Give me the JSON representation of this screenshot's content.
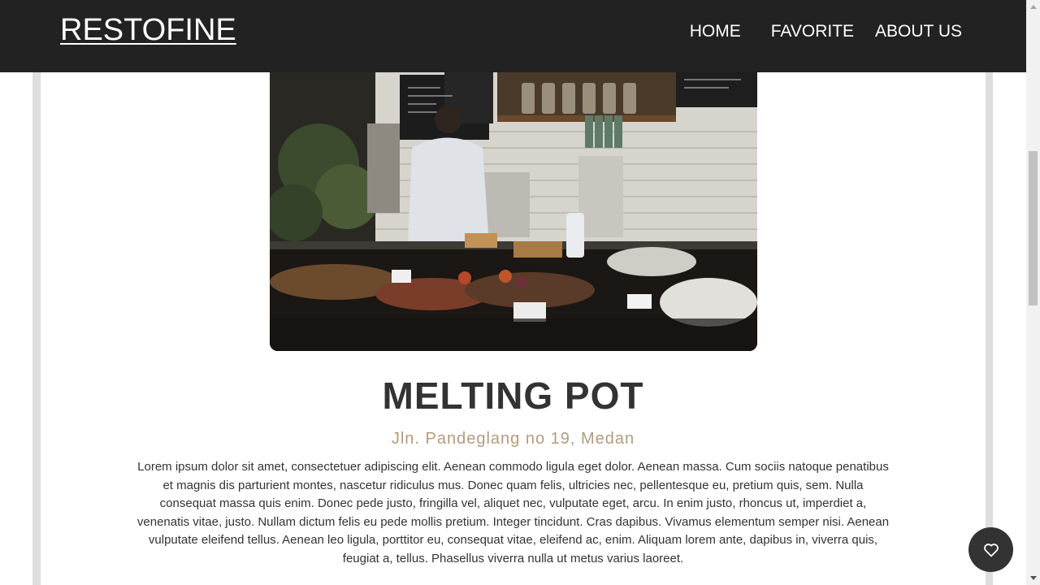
{
  "header": {
    "brand": "RESTOFINE",
    "nav": {
      "home": "HOME",
      "favorite": "FAVORITE",
      "about": "ABOUT US"
    }
  },
  "restaurant": {
    "name": "MELTING POT",
    "address": "Jln. Pandeglang no 19, Medan",
    "description": "Lorem ipsum dolor sit amet, consectetuer adipiscing elit. Aenean commodo ligula eget dolor. Aenean massa. Cum sociis natoque penatibus et magnis dis parturient montes, nascetur ridiculus mus. Donec quam felis, ultricies nec, pellentesque eu, pretium quis, sem. Nulla consequat massa quis enim. Donec pede justo, fringilla vel, aliquet nec, vulputate eget, arcu. In enim justo, rhoncus ut, imperdiet a, venenatis vitae, justo. Nullam dictum felis eu pede mollis pretium. Integer tincidunt. Cras dapibus. Vivamus elementum semper nisi. Aenean vulputate eleifend tellus. Aenean leo ligula, porttitor eu, consequat vitae, eleifend ac, enim. Aliquam lorem ante, dapibus in, viverra quis, feugiat a, tellus. Phasellus viverra nulla ut metus varius laoreet."
  },
  "icons": {
    "favorite_button": "heart-outline-icon"
  },
  "colors": {
    "header_bg": "#222222",
    "accent_address": "#b39b7e",
    "fab_bg": "#333333"
  }
}
